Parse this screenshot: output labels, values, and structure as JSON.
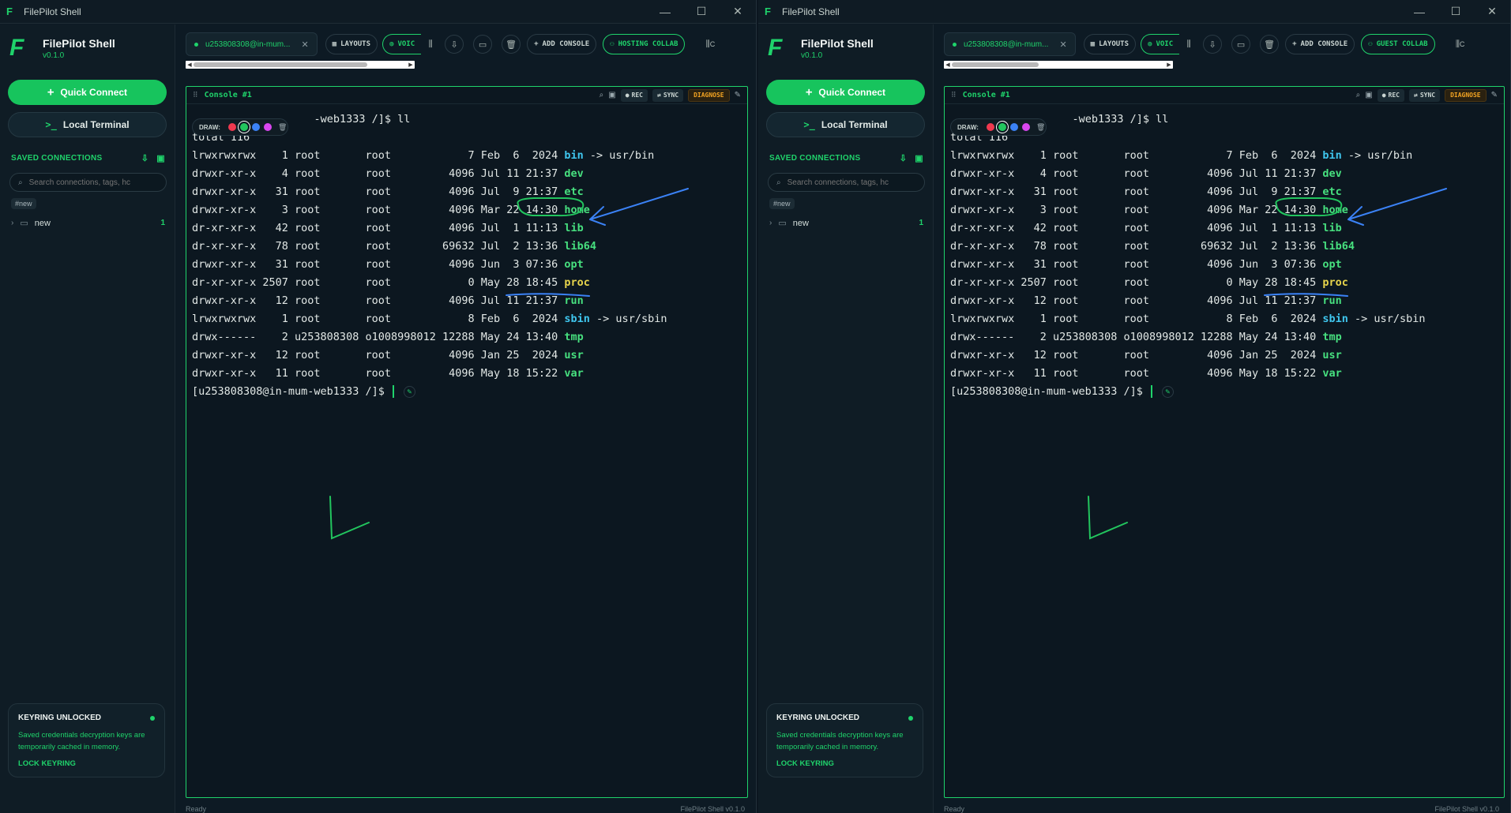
{
  "window": {
    "title": "FilePilot Shell",
    "minimize": "—",
    "maximize": "☐",
    "close": "✕"
  },
  "sidebar": {
    "brand_name": "FilePilot Shell",
    "version": "v0.1.0",
    "quick_connect": "Quick Connect",
    "local_terminal": "Local Terminal",
    "saved_connections": "SAVED CONNECTIONS",
    "search_placeholder": "Search connections, tags, hc",
    "tag": "#new",
    "folder": {
      "name": "new",
      "count": "1"
    },
    "keyring": {
      "title": "KEYRING UNLOCKED",
      "desc": "Saved credentials decryption keys are temporarily cached in memory.",
      "lock": "LOCK KEYRING"
    }
  },
  "tabs": {
    "session": "u253808308@in-mum...",
    "layouts": "LAYOUTS",
    "voice": "VOIC",
    "add_console": "ADD CONSOLE",
    "hosting_collab": "HOSTING COLLAB",
    "guest_collab": "GUEST COLLAB",
    "overflow": "C"
  },
  "console": {
    "title": "Console #1",
    "rec": "REC",
    "sync": "SYNC",
    "diagnose": "DIAGNOSE",
    "draw_label": "DRAW:",
    "draw_colors": [
      "#f0394f",
      "#22c55e",
      "#3b82f6",
      "#d946ef"
    ],
    "prompt_head": "-web1333 /]$ ll",
    "total": "total 116",
    "rows": [
      {
        "perms": "lrwxrwxrwx",
        "links": "1",
        "owner": "root",
        "group": "root",
        "size": "7",
        "date": "Feb  6  2024",
        "name": "bin",
        "target": "-> usr/bin",
        "kind": "link"
      },
      {
        "perms": "drwxr-xr-x",
        "links": "4",
        "owner": "root",
        "group": "root",
        "size": "4096",
        "date": "Jul 11 21:37",
        "name": "dev",
        "target": "",
        "kind": "dir"
      },
      {
        "perms": "drwxr-xr-x",
        "links": "31",
        "owner": "root",
        "group": "root",
        "size": "4096",
        "date": "Jul  9 21:37",
        "name": "etc",
        "target": "",
        "kind": "dir"
      },
      {
        "perms": "drwxr-xr-x",
        "links": "3",
        "owner": "root",
        "group": "root",
        "size": "4096",
        "date": "Mar 22 14:30",
        "name": "home",
        "target": "",
        "kind": "dir"
      },
      {
        "perms": "dr-xr-xr-x",
        "links": "42",
        "owner": "root",
        "group": "root",
        "size": "4096",
        "date": "Jul  1 11:13",
        "name": "lib",
        "target": "",
        "kind": "dir"
      },
      {
        "perms": "dr-xr-xr-x",
        "links": "78",
        "owner": "root",
        "group": "root",
        "size": "69632",
        "date": "Jul  2 13:36",
        "name": "lib64",
        "target": "",
        "kind": "dir"
      },
      {
        "perms": "drwxr-xr-x",
        "links": "31",
        "owner": "root",
        "group": "root",
        "size": "4096",
        "date": "Jun  3 07:36",
        "name": "opt",
        "target": "",
        "kind": "dir"
      },
      {
        "perms": "dr-xr-xr-x",
        "links": "2507",
        "owner": "root",
        "group": "root",
        "size": "0",
        "date": "May 28 18:45",
        "name": "proc",
        "target": "",
        "kind": "proc"
      },
      {
        "perms": "drwxr-xr-x",
        "links": "12",
        "owner": "root",
        "group": "root",
        "size": "4096",
        "date": "Jul 11 21:37",
        "name": "run",
        "target": "",
        "kind": "dir"
      },
      {
        "perms": "lrwxrwxrwx",
        "links": "1",
        "owner": "root",
        "group": "root",
        "size": "8",
        "date": "Feb  6  2024",
        "name": "sbin",
        "target": "-> usr/sbin",
        "kind": "link"
      },
      {
        "perms": "drwx------",
        "links": "2",
        "owner": "u253808308",
        "group": "o1008998012",
        "size": "12288",
        "date": "May 24 13:40",
        "name": "tmp",
        "target": "",
        "kind": "dir"
      },
      {
        "perms": "drwxr-xr-x",
        "links": "12",
        "owner": "root",
        "group": "root",
        "size": "4096",
        "date": "Jan 25  2024",
        "name": "usr",
        "target": "",
        "kind": "dir"
      },
      {
        "perms": "drwxr-xr-x",
        "links": "11",
        "owner": "root",
        "group": "root",
        "size": "4096",
        "date": "May 18 15:22",
        "name": "var",
        "target": "",
        "kind": "dir"
      }
    ],
    "prompt": "[u253808308@in-mum-web1333 /]$"
  },
  "status": {
    "left": "Ready",
    "right": "FilePilot Shell v0.1.0"
  },
  "colors": {
    "accent": "#1fd36b",
    "annotation_green": "#22c55e",
    "annotation_blue": "#3b82f6"
  }
}
